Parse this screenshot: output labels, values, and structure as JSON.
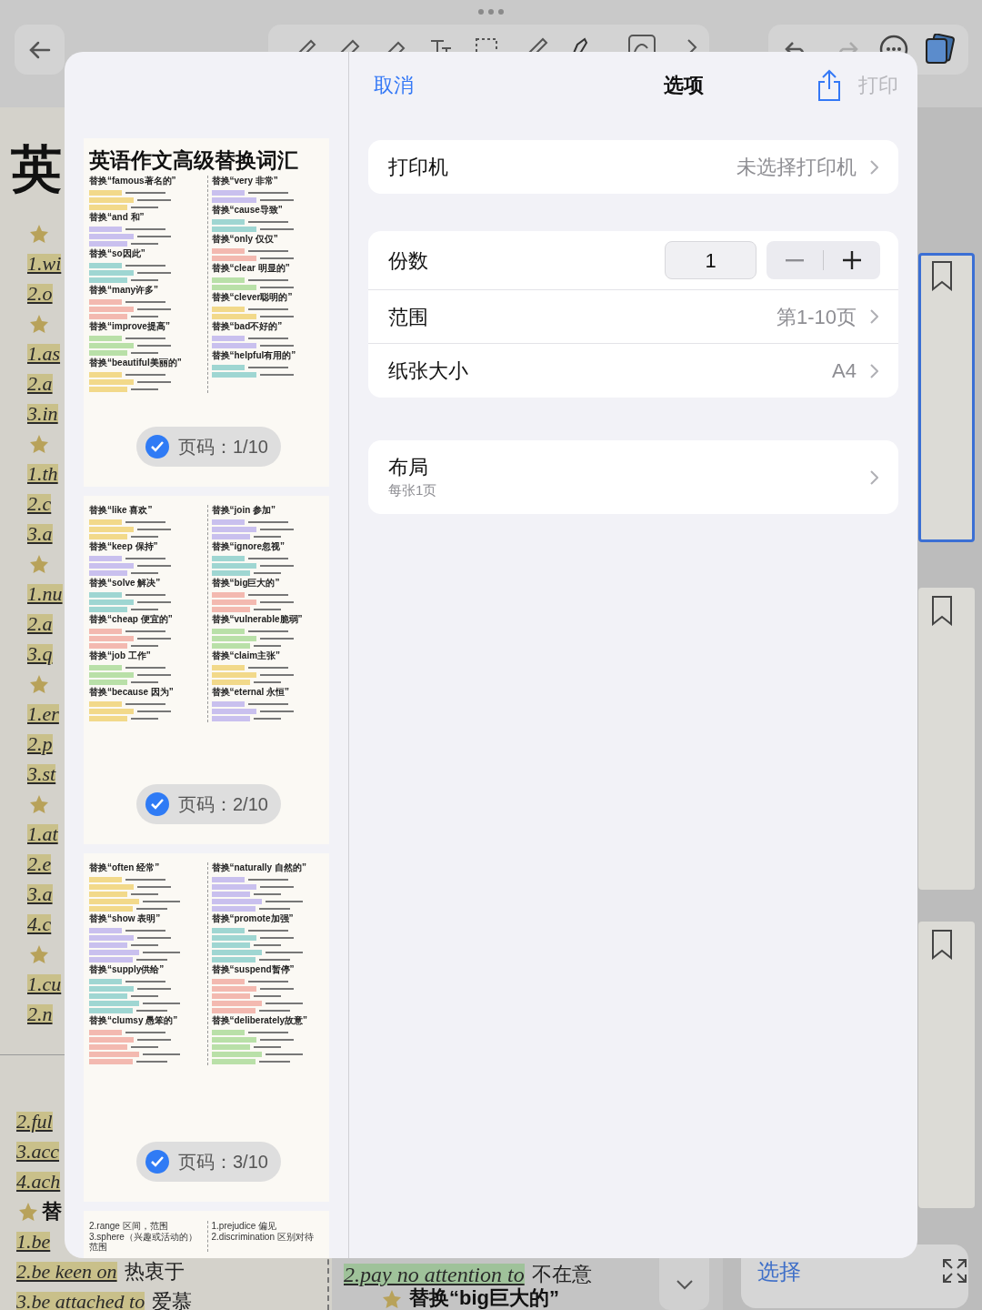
{
  "background": {
    "big_char": "英",
    "left_items": [
      {
        "kind": "star"
      },
      {
        "kind": "text",
        "text": "1.wi"
      },
      {
        "kind": "text",
        "text": "2.o"
      },
      {
        "kind": "star"
      },
      {
        "kind": "text",
        "text": "1.as"
      },
      {
        "kind": "text",
        "text": "2.a"
      },
      {
        "kind": "text",
        "text": "3.in"
      },
      {
        "kind": "star"
      },
      {
        "kind": "text",
        "text": "1.th"
      },
      {
        "kind": "text",
        "text": "2.c"
      },
      {
        "kind": "text",
        "text": "3.a"
      },
      {
        "kind": "star"
      },
      {
        "kind": "text",
        "text": "1.nu"
      },
      {
        "kind": "text",
        "text": "2.a"
      },
      {
        "kind": "text",
        "text": "3.q"
      },
      {
        "kind": "star"
      },
      {
        "kind": "text",
        "text": "1.er"
      },
      {
        "kind": "text",
        "text": "2.p"
      },
      {
        "kind": "text",
        "text": "3.st"
      },
      {
        "kind": "star"
      },
      {
        "kind": "text",
        "text": "1.at"
      },
      {
        "kind": "text",
        "text": "2.e"
      },
      {
        "kind": "text",
        "text": "3.a"
      },
      {
        "kind": "text",
        "text": "4.c"
      },
      {
        "kind": "star"
      },
      {
        "kind": "text",
        "text": "1.cu"
      },
      {
        "kind": "text",
        "text": "2.n"
      }
    ],
    "lower_items": [
      {
        "kind": "text",
        "text": "2.ful"
      },
      {
        "kind": "text",
        "text": "3.acc"
      },
      {
        "kind": "text",
        "text": "4.ach"
      },
      {
        "kind": "heading",
        "text": "替"
      },
      {
        "kind": "text",
        "text": "1.be"
      },
      {
        "kind": "text",
        "text": "2.be keen on",
        "note": "热衷于"
      },
      {
        "kind": "text",
        "text": "3.be attached to",
        "note": "爱慕"
      }
    ],
    "middle_items": [
      {
        "kind": "text",
        "text": "2.pay no attention to",
        "note": "不在意"
      },
      {
        "kind": "heading",
        "text": "替换“big巨大的”"
      }
    ],
    "select_button": "选择"
  },
  "dialog": {
    "cancel": "取消",
    "title": "选项",
    "print": "打印",
    "print_enabled": false,
    "printer": {
      "label": "打印机",
      "value": "未选择打印机"
    },
    "copies": {
      "label": "份数",
      "value": "1",
      "minus_enabled": false
    },
    "rows": [
      {
        "label": "范围",
        "value": "第1-10页"
      },
      {
        "label": "纸张大小",
        "value": "A4"
      }
    ],
    "layout": {
      "label": "布局",
      "subtitle": "每张1页"
    }
  },
  "pages": [
    {
      "title": "英语作文高级替换词汇",
      "badge": "页码：1/10",
      "selected": true,
      "left": [
        "替换“famous著名的”",
        "替换“and 和”",
        "替换“so因此”",
        "替换“many许多”",
        "替换“improve提高”",
        "替换“beautiful美丽的”"
      ],
      "right": [
        "替换“very 非常”",
        "替换“cause导致”",
        "替换“only 仅仅”",
        "替换“clear 明显的”",
        "替换“clever聪明的”",
        "替换“bad不好的”",
        "替换“helpful有用的”"
      ]
    },
    {
      "badge": "页码：2/10",
      "selected": true,
      "left": [
        "替换“like 喜欢”",
        "替换“keep 保持”",
        "替换“solve 解决”",
        "替换“cheap 便宜的”",
        "替换“job 工作”",
        "替换“because 因为”"
      ],
      "right": [
        "替换“join 参加”",
        "替换“ignore忽视”",
        "替换“big巨大的”",
        "替换“vulnerable脆弱”",
        "替换“claim主张”",
        "替换“eternal 永恒”"
      ]
    },
    {
      "badge": "页码：3/10",
      "selected": true,
      "left": [
        "替换“often 经常”",
        "替换“show 表明”",
        "替换“supply供给”",
        "替换“clumsy 愚笨的”"
      ],
      "right": [
        "替换“naturally 自然的”",
        "替换“promote加强”",
        "替换“suspend暂停”",
        "替换“deliberately故意”"
      ]
    },
    {
      "left_entries": [
        "2.range 区间，范围",
        "3.sphere（兴趣或活动的）范围"
      ],
      "right_entries": [
        "1.prejudice 偏见",
        "2.discrimination 区别对待"
      ]
    }
  ]
}
